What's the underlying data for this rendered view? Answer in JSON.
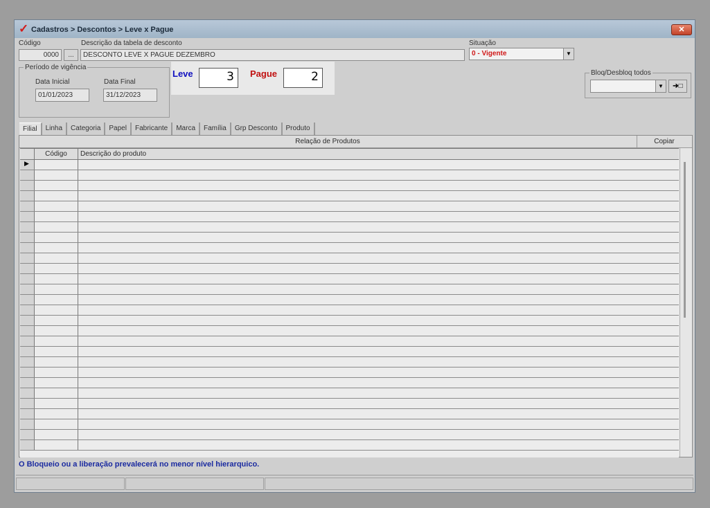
{
  "window": {
    "title": "Cadastros > Descontos > Leve x Pague",
    "close_label": "✕"
  },
  "codigo": {
    "label": "Código",
    "value": "0000",
    "lookup_label": "..."
  },
  "descricao": {
    "label": "Descrição da tabela de desconto",
    "value": "DESCONTO LEVE X PAGUE DEZEMBRO"
  },
  "situacao": {
    "label": "Situação",
    "value": "0 - Vigente",
    "color": "#d01818"
  },
  "periodo": {
    "legend": "Período de vigência",
    "inicial_label": "Data Inicial",
    "inicial_value": "01/01/2023",
    "final_label": "Data Final",
    "final_value": "31/12/2023"
  },
  "leve": {
    "label": "Leve",
    "value": "3",
    "color": "#1010c0"
  },
  "pague": {
    "label": "Pague",
    "value": "2",
    "color": "#c01010"
  },
  "bloq": {
    "legend": "Bloq/Desbloq todos",
    "value": "",
    "apply_label": "➔□"
  },
  "tabs": [
    "Filial",
    "Linha",
    "Categoria",
    "Papel",
    "Fabricante",
    "Marca",
    "Família",
    "Grp Desconto",
    "Produto"
  ],
  "panel": {
    "title": "Relação de Produtos",
    "copy_label": "Copiar"
  },
  "grid": {
    "col_codigo": "Código",
    "col_descricao": "Descrição do produto"
  },
  "status": {
    "message": "O Bloqueio ou a liberação prevalecerá no menor nível hierarquico."
  }
}
